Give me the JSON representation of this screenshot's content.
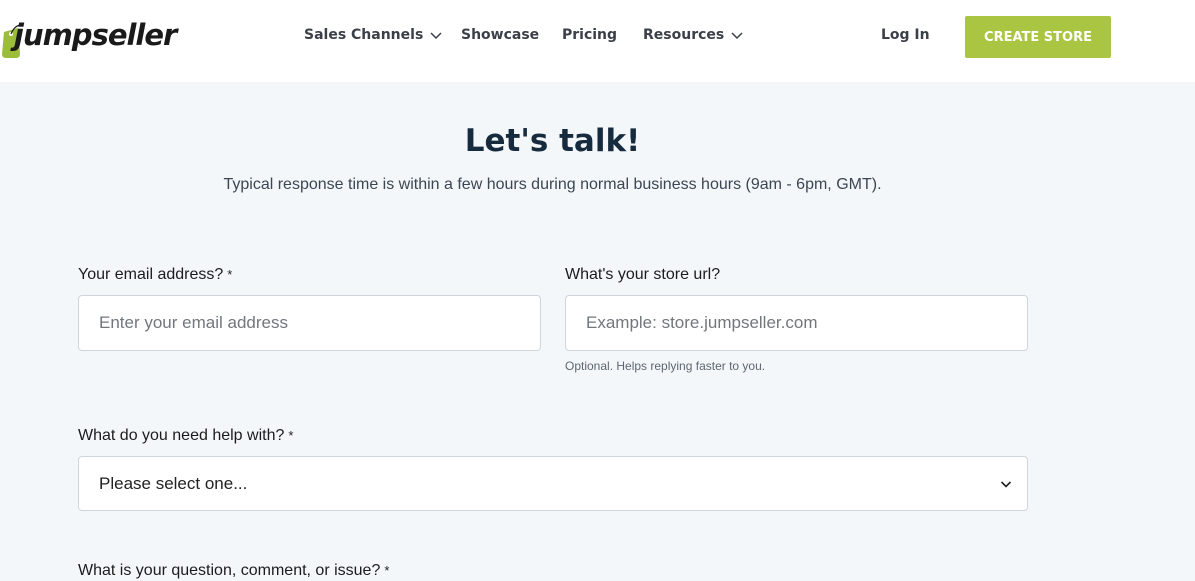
{
  "header": {
    "logo_text": "jumpseller",
    "nav": {
      "sales_channels": "Sales Channels",
      "showcase": "Showcase",
      "pricing": "Pricing",
      "resources": "Resources",
      "login": "Log In"
    },
    "cta_label": "CREATE STORE"
  },
  "hero": {
    "title": "Let's talk!",
    "subtitle": "Typical response time is within a few hours during normal business hours (9am - 6pm, GMT)."
  },
  "form": {
    "email": {
      "label": "Your email address?",
      "required_mark": "*",
      "placeholder": "Enter your email address",
      "value": ""
    },
    "store_url": {
      "label": "What's your store url?",
      "placeholder": "Example: store.jumpseller.com",
      "value": "",
      "help": "Optional. Helps replying faster to you."
    },
    "help_topic": {
      "label": "What do you need help with?",
      "required_mark": "*",
      "selected": "Please select one..."
    },
    "question": {
      "label": "What is your question, comment, or issue?",
      "required_mark": "*"
    }
  },
  "colors": {
    "brand_green": "#a9c542",
    "title_navy": "#172b3e",
    "page_bg": "#f4f7fa"
  },
  "icons": {
    "dropdown": "chevron-down-icon",
    "logo_tag": "price-tag-icon"
  }
}
